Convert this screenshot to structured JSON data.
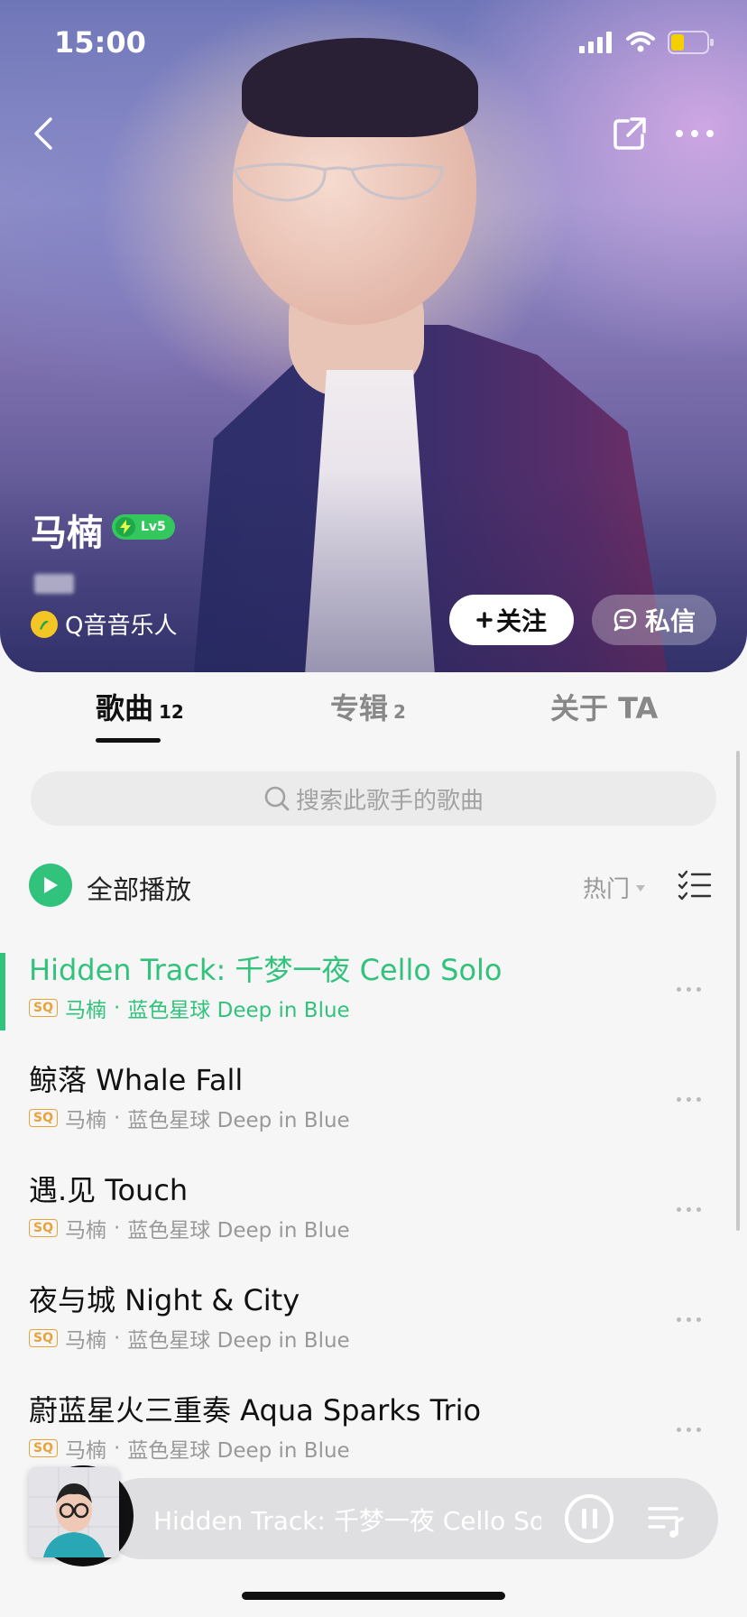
{
  "status": {
    "time": "15:00"
  },
  "artist": {
    "name": "马楠",
    "level": "Lv5",
    "musician_label": "Q音音乐人",
    "follow_label": "关注",
    "message_label": "私信"
  },
  "tabs": [
    {
      "label": "歌曲",
      "count": "12"
    },
    {
      "label": "专辑",
      "count": "2"
    },
    {
      "label": "关于 TA",
      "count": ""
    }
  ],
  "search": {
    "placeholder": "搜索此歌手的歌曲"
  },
  "list_header": {
    "play_all": "全部播放",
    "sort": "热门"
  },
  "songs": [
    {
      "title": "Hidden Track: 千梦一夜 Cello Solo",
      "quality": "SQ",
      "artist": "马楠",
      "album": "蓝色星球 Deep in Blue"
    },
    {
      "title": "鲸落 Whale Fall",
      "quality": "SQ",
      "artist": "马楠",
      "album": "蓝色星球 Deep in Blue"
    },
    {
      "title": "遇.见 Touch",
      "quality": "SQ",
      "artist": "马楠",
      "album": "蓝色星球 Deep in Blue"
    },
    {
      "title": "夜与城 Night & City",
      "quality": "SQ",
      "artist": "马楠",
      "album": "蓝色星球 Deep in Blue"
    },
    {
      "title": "蔚蓝星火三重奏 Aqua Sparks Trio",
      "quality": "SQ",
      "artist": "马楠",
      "album": "蓝色星球 Deep in Blue"
    }
  ],
  "mini_player": {
    "title": "Hidden Track: 千梦一夜 Cello Solo"
  },
  "colors": {
    "accent": "#31c27c",
    "sq": "#e7a33a"
  },
  "icons": [
    "back-icon",
    "share-icon",
    "more-icon",
    "signal-icon",
    "wifi-icon",
    "battery-icon",
    "play-icon",
    "list-mode-icon",
    "pause-icon",
    "playlist-icon",
    "search-icon",
    "chat-icon"
  ]
}
